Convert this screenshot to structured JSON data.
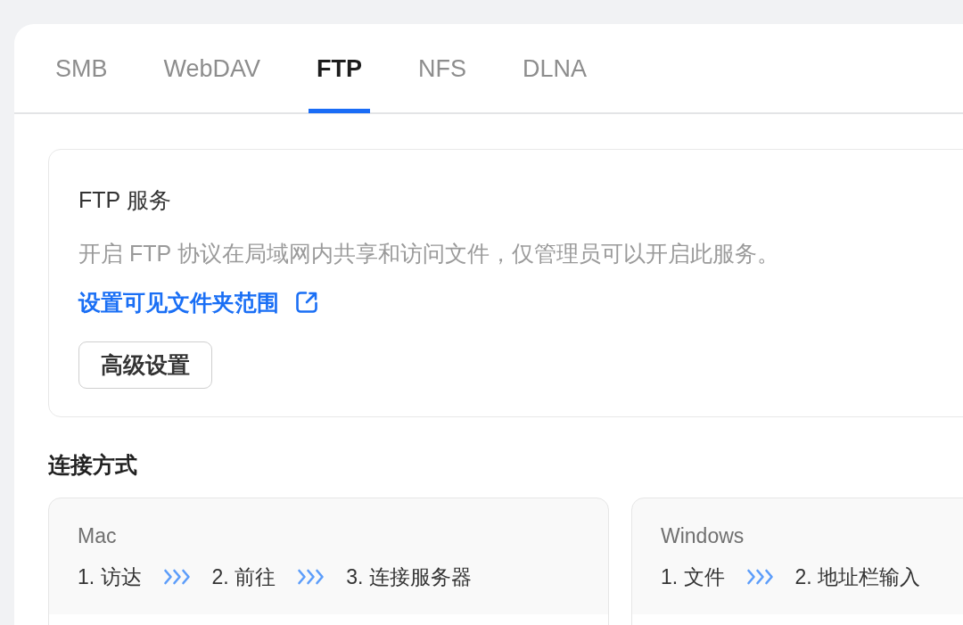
{
  "tabs": [
    {
      "label": "SMB",
      "selected": false
    },
    {
      "label": "WebDAV",
      "selected": false
    },
    {
      "label": "FTP",
      "selected": true
    },
    {
      "label": "NFS",
      "selected": false
    },
    {
      "label": "DLNA",
      "selected": false
    }
  ],
  "service_card": {
    "title": "FTP 服务",
    "description": "开启 FTP 协议在局域网内共享和访问文件，仅管理员可以开启此服务。",
    "link": "设置可见文件夹范围",
    "button": "高级设置"
  },
  "connection": {
    "heading": "连接方式",
    "methods": [
      {
        "platform": "Mac",
        "steps": [
          "1. 访达",
          "2. 前往",
          "3. 连接服务器"
        ]
      },
      {
        "platform": "Windows",
        "steps": [
          "1. 文件",
          "2. 地址栏输入"
        ]
      }
    ]
  }
}
